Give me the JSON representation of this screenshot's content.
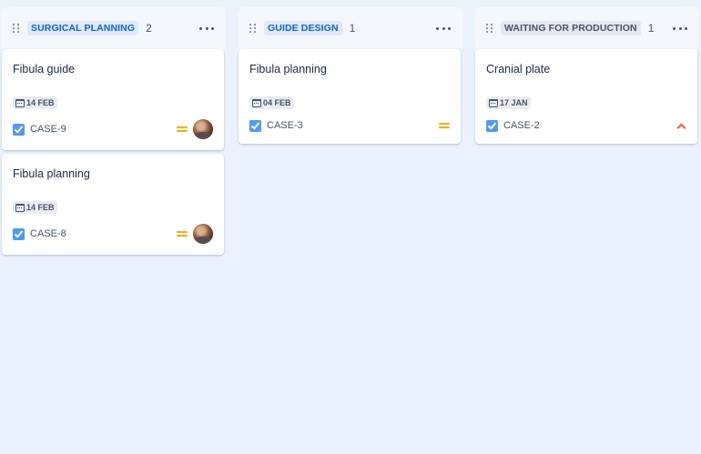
{
  "columns": [
    {
      "title": "SURGICAL PLANNING",
      "count": "2",
      "cards": [
        {
          "title": "Fibula guide",
          "date": "14 FEB",
          "key": "CASE-9",
          "priority": "medium",
          "assignee": true
        },
        {
          "title": "Fibula planning",
          "date": "14 FEB",
          "key": "CASE-8",
          "priority": "medium",
          "assignee": true
        }
      ]
    },
    {
      "title": "GUIDE DESIGN",
      "count": "1",
      "cards": [
        {
          "title": "Fibula planning",
          "date": "04 FEB",
          "key": "CASE-3",
          "priority": "medium",
          "assignee": false
        }
      ]
    },
    {
      "title": "WAITING FOR PRODUCTION",
      "count": "1",
      "cards": [
        {
          "title": "Cranial plate",
          "date": "17 JAN",
          "key": "CASE-2",
          "priority": "high",
          "assignee": false
        }
      ]
    }
  ],
  "colors": {
    "board_background": "#e9f2fd",
    "priority_medium": "#ffab00",
    "priority_high": "#ff5630",
    "checkbox": "#4c9aff"
  }
}
